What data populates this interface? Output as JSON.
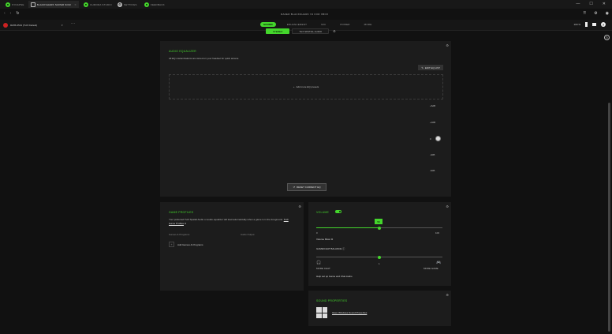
{
  "tabs": [
    {
      "label": "SYNAPSE",
      "icon": "razer-icon",
      "active": false
    },
    {
      "label": "BLACKSHARK SUPER SOUND",
      "icon": "app-icon",
      "active": true
    },
    {
      "label": "CHROMA STUDIO",
      "icon": "chroma-icon",
      "active": false
    },
    {
      "label": "SETTINGS",
      "icon": "gear-icon",
      "active": false
    },
    {
      "label": "FEEDBACK",
      "icon": "feedback-icon",
      "active": false
    }
  ],
  "window": {
    "minimize": "—",
    "maximize": "☐",
    "close": "✕"
  },
  "nav": {
    "back": "‹",
    "forward": "›",
    "reload": "↻",
    "app_title": "RAZER BLACKSHARK V3 FOR XBOX"
  },
  "device": {
    "name": "RZ05-0519 (THX Default)"
  },
  "navtabs": [
    {
      "label": "SOUND",
      "active": true
    },
    {
      "label": "ENHANCEMENT",
      "active": false
    },
    {
      "label": "MIC",
      "active": false
    },
    {
      "label": "POWER",
      "active": false
    },
    {
      "label": "MORE",
      "active": false
    }
  ],
  "status": {
    "battery": "100 %"
  },
  "subtabs": [
    {
      "label": "STEREO",
      "active": true
    },
    {
      "label": "THX SPATIAL AUDIO",
      "active": false
    }
  ],
  "equalizer": {
    "title": "AUDIO EQUALIZER",
    "description": "All EQ customizations are stored on your headset for quick access.",
    "edit_label": "EDIT EQ LIST",
    "presets_label": "Add more EQ presets",
    "db_labels": [
      "+6dB",
      "+3dB",
      "0",
      "-3dB",
      "-6dB"
    ],
    "reset_label": "RESET CURRENT EQ"
  },
  "game_profiles": {
    "title": "GAME PROFILES",
    "description": "Your preferred THX Spatial Audio or audio equalizer will load automatically when a game is in the foreground.",
    "link": "THX Game Profiles",
    "col1": "Games & Programs",
    "col2": "Audio Output",
    "add_label": "Add Games & Programs"
  },
  "volume": {
    "title": "VOLUME",
    "value": 50,
    "value_label": "50",
    "min_label": "0",
    "max_label": "100",
    "mixer_link": "Volume Mixer",
    "balance_title": "GAME/CHAT BALANCE",
    "balance_value": 0.5,
    "balance_left": "MORE CHAT",
    "balance_mid": "1",
    "balance_right": "MORE GAME",
    "help_link": "Help set up Game and Chat Audio"
  },
  "sound_properties": {
    "title": "SOUND PROPERTIES",
    "link": "Open Windows Sound Properties"
  }
}
